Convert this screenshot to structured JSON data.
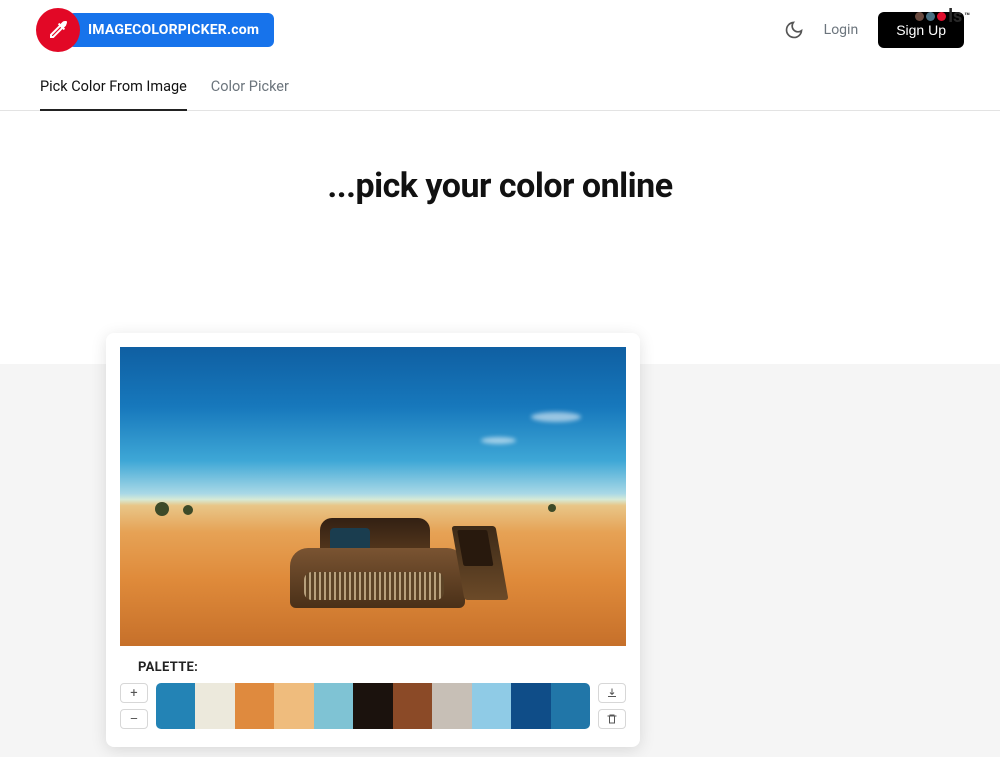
{
  "header": {
    "brand": "IMAGECOLORPICKER.com",
    "login_label": "Login",
    "signup_label": "Sign Up",
    "watermark_suffix": "ls"
  },
  "tabs": {
    "pick_from_image": "Pick Color From Image",
    "color_picker": "Color Picker"
  },
  "hero": {
    "title": "...pick your color online"
  },
  "palette": {
    "label": "PALETTE:",
    "plus": "+",
    "minus": "–",
    "colors": [
      "#2383b5",
      "#ece9dc",
      "#df8a3e",
      "#efbc7d",
      "#7fc3d4",
      "#1b120d",
      "#8b4a27",
      "#c7bfb6",
      "#8fcbe6",
      "#0f4d88",
      "#2176a8"
    ]
  }
}
